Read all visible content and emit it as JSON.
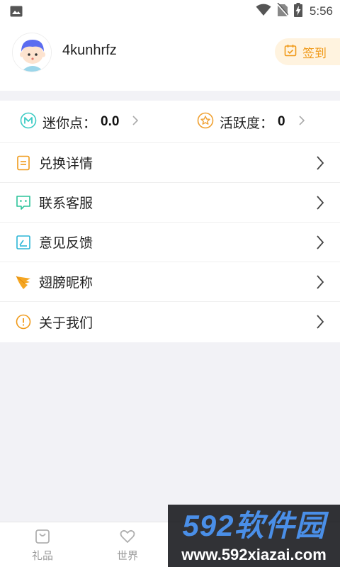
{
  "status_bar": {
    "time": "5:56",
    "icons": [
      "image-icon",
      "wifi-icon",
      "no-sim-icon",
      "battery-charging-icon"
    ]
  },
  "profile": {
    "username": "4kunhrfz",
    "signin_label": "签到",
    "signin_icon": "calendar-check-icon",
    "accent_color": "#f09a1a"
  },
  "stats": {
    "mini_points": {
      "label": "迷你点：",
      "value": "0.0",
      "icon": "m-coin-icon"
    },
    "activity": {
      "label": "活跃度：",
      "value": "0",
      "icon": "star-circle-icon"
    }
  },
  "menu": {
    "items": [
      {
        "label": "兑换详情",
        "icon": "document-icon"
      },
      {
        "label": "联系客服",
        "icon": "chat-bubble-icon"
      },
      {
        "label": "意见反馈",
        "icon": "feedback-edit-icon"
      },
      {
        "label": "翅膀昵称",
        "icon": "wing-icon"
      },
      {
        "label": "关于我们",
        "icon": "info-icon"
      }
    ]
  },
  "tabbar": {
    "tabs": [
      {
        "label": "礼品",
        "icon": "gift-bag-icon"
      },
      {
        "label": "世界",
        "icon": "heart-icon"
      }
    ]
  },
  "watermark": {
    "brand": "592软件园",
    "url": "www.592xiazai.com"
  }
}
